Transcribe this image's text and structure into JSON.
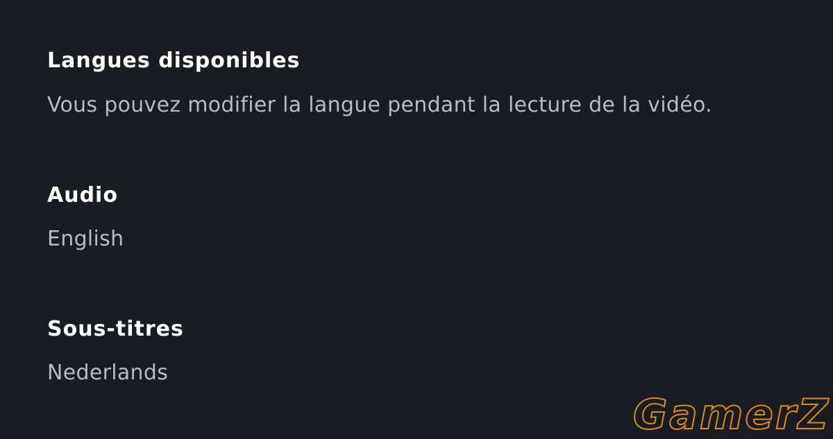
{
  "languages": {
    "title": "Langues disponibles",
    "description": "Vous pouvez modifier la langue pendant la lecture de la vidéo."
  },
  "audio": {
    "title": "Audio",
    "value": "English"
  },
  "subtitles": {
    "title": "Sous-titres",
    "value": "Nederlands"
  },
  "watermark": {
    "text": "GamerZ"
  },
  "colors": {
    "background": "#1a1c23",
    "heading": "#ffffff",
    "body_text": "#b9bbbf",
    "watermark_stroke": "#e08a1c"
  }
}
